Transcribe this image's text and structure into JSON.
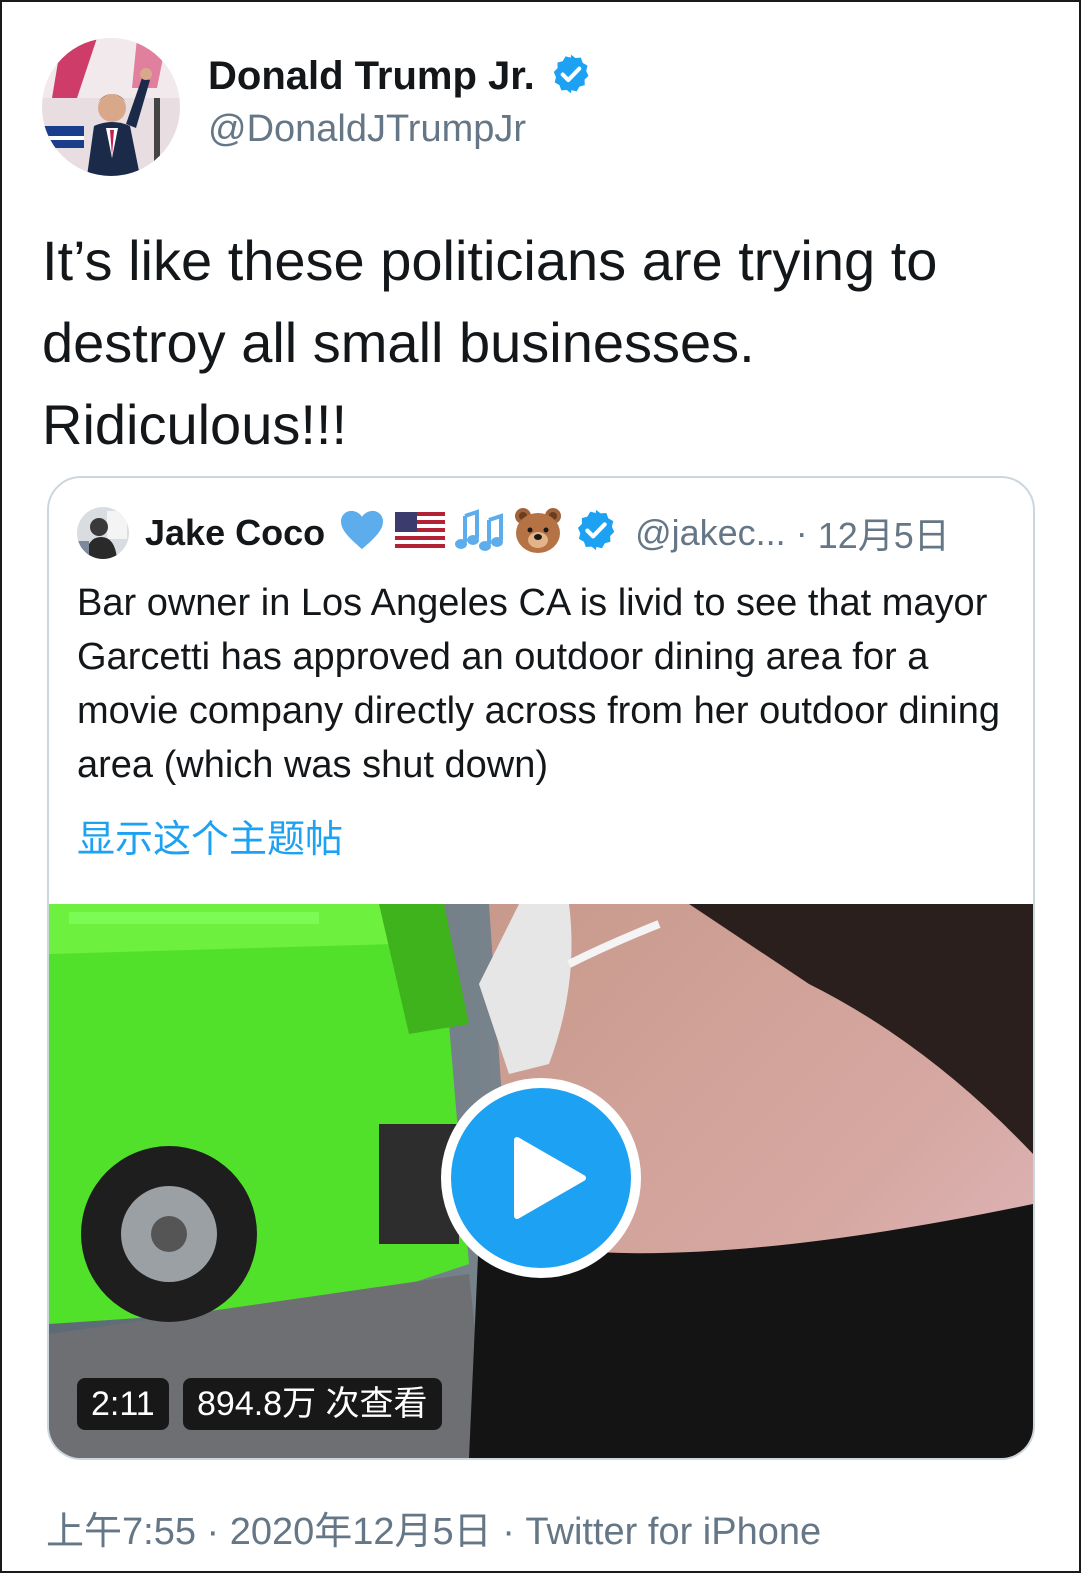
{
  "author": {
    "name": "Donald Trump Jr.",
    "handle": "@DonaldJTrumpJr",
    "verified_icon": "verified-badge-icon"
  },
  "tweet": {
    "text": "It’s like these politicians are trying to destroy all small businesses. Ridiculous!!!"
  },
  "quoted": {
    "name": "Jake Coco",
    "emojis": [
      "blue-heart-icon",
      "us-flag-icon",
      "music-notes-icon",
      "bear-face-icon"
    ],
    "handle": "@jakec...",
    "separator": "·",
    "date": "12月5日",
    "text": "Bar owner in Los Angeles CA is livid to see that mayor Garcetti has approved an outdoor dining area for a movie company directly across from her outdoor dining area (which was shut down)",
    "show_thread": "显示这个主题帖",
    "video": {
      "duration": "2:11",
      "views": "894.8万 次查看"
    }
  },
  "footer": {
    "timestamp": "上午7:55 · 2020年12月5日 · Twitter for iPhone"
  },
  "colors": {
    "accent": "#1da1f2",
    "text": "#14171a",
    "secondary": "#657786"
  }
}
